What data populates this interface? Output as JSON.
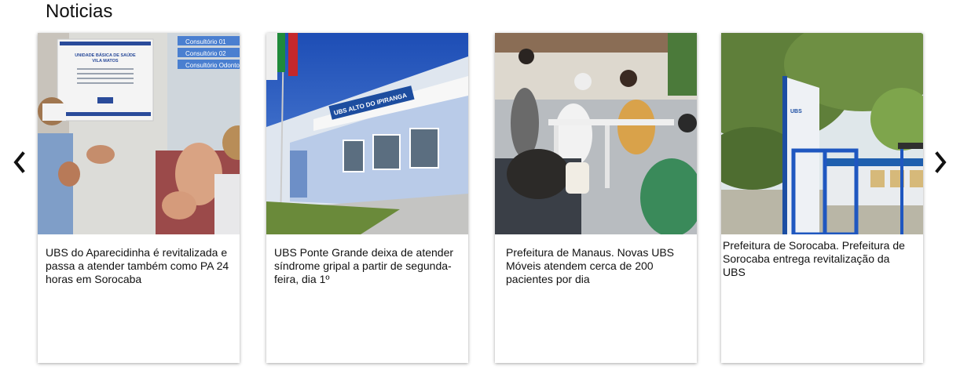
{
  "section": {
    "title": "Noticias"
  },
  "carousel": {
    "prev_icon": "chevron-left-icon",
    "next_icon": "chevron-right-icon",
    "cards": [
      {
        "text": "UBS do Aparecidinha é revitalizada e passa a atender também como PA 24 horas em Sorocaba",
        "image_sign_title": "UNIDADE BÁSICA DE SAÚDE",
        "image_sign_subtitle": "VILA MATOS",
        "image_door_labels": [
          "Consultório 01",
          "Consultório 02",
          "Consultório Odontol"
        ]
      },
      {
        "text": "UBS Ponte Grande deixa de atender síndrome gripal a partir de segunda-feira, dia 1º",
        "image_sign": "UBS ALTO DO IPIRANGA"
      },
      {
        "text": " Prefeitura de Manaus. Novas UBS Móveis atendem cerca de 200 pacientes por dia"
      },
      {
        "text": " Prefeitura de Sorocaba. Prefeitura de Sorocaba entrega revitalização da UBS",
        "image_sign": "UBS"
      }
    ]
  }
}
